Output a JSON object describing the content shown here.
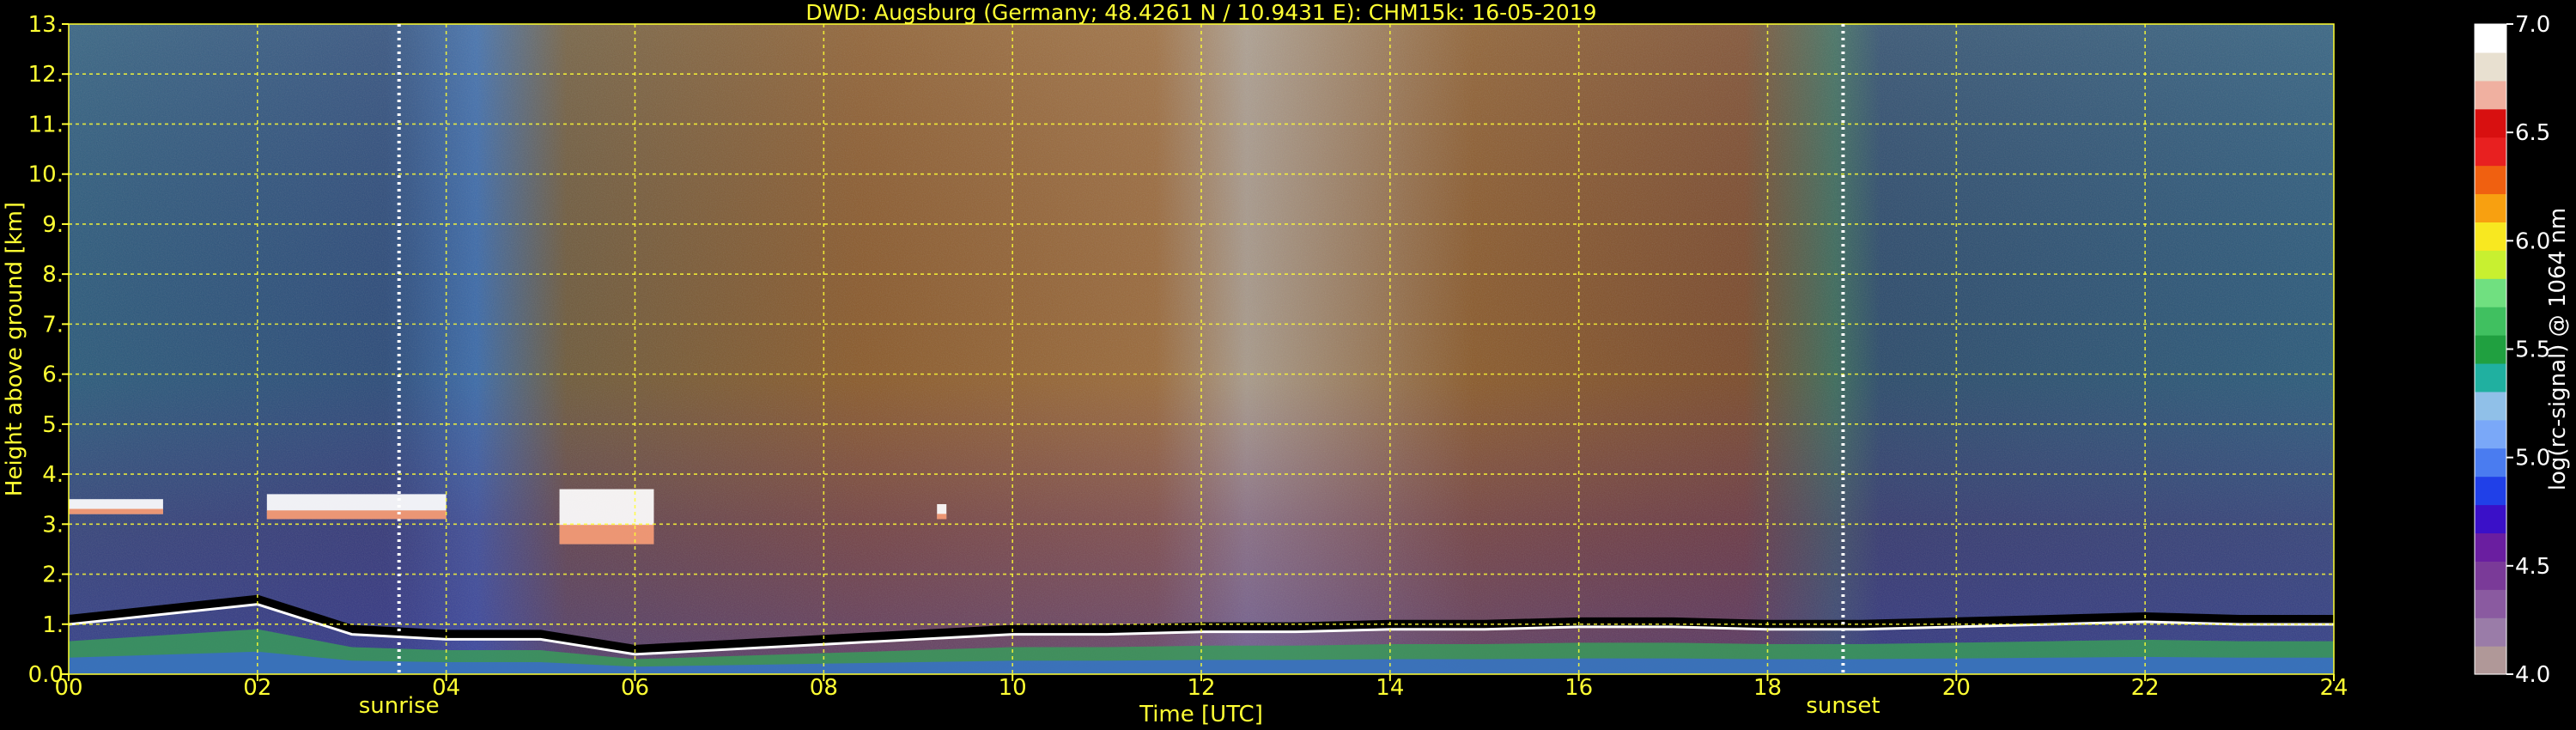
{
  "chart_data": {
    "type": "heatmap",
    "title": "DWD: Augsburg (Germany; 48.4261 N / 10.9431 E):    CHM15k: 16-05-2019",
    "xlabel": "Time [UTC]",
    "ylabel": "Height above ground [km]",
    "colorbar_label": "log(rc-signal) @ 1064 nm",
    "xlim": [
      0,
      24
    ],
    "ylim": [
      0,
      13
    ],
    "clim": [
      4.0,
      7.0
    ],
    "x_ticks": [
      "00",
      "02",
      "04",
      "06",
      "08",
      "10",
      "12",
      "14",
      "16",
      "18",
      "20",
      "22",
      "24"
    ],
    "y_ticks": [
      "0.0",
      "1.",
      "2.",
      "3.",
      "4.",
      "5.",
      "6.",
      "7.",
      "8.",
      "9.",
      "10.",
      "11.",
      "12.",
      "13."
    ],
    "colorbar_ticks": [
      "4.0",
      "4.5",
      "5.0",
      "5.5",
      "6.0",
      "6.5",
      "7.0"
    ],
    "grid": true,
    "grid_color": "#ffff33",
    "colormap": [
      "#b09898",
      "#9a7ca8",
      "#8a5aa0",
      "#7a3a98",
      "#6a1ea0",
      "#3a10c8",
      "#2040e8",
      "#4a7cf0",
      "#7aa8f8",
      "#90c0e8",
      "#20b0a0",
      "#20a040",
      "#40c060",
      "#70e080",
      "#c8f030",
      "#f8e820",
      "#f8a010",
      "#f06010",
      "#e82020",
      "#d81010",
      "#f0b0a0",
      "#e8e0d0",
      "#ffffff"
    ],
    "events": [
      {
        "label": "sunrise",
        "x": 3.5
      },
      {
        "label": "sunset",
        "x": 18.8
      }
    ],
    "cloud_layers": [
      {
        "x": [
          0.0,
          1.0
        ],
        "y": [
          3.2,
          3.5
        ]
      },
      {
        "x": [
          2.1,
          4.0
        ],
        "y": [
          3.1,
          3.6
        ]
      },
      {
        "x": [
          5.2,
          6.2
        ],
        "y": [
          2.6,
          3.7
        ]
      },
      {
        "x": [
          9.2,
          9.3
        ],
        "y": [
          3.1,
          3.4
        ]
      }
    ],
    "boundary_layer": {
      "x": [
        0,
        1,
        2,
        3,
        4,
        5,
        6,
        7,
        8,
        9,
        10,
        11,
        12,
        13,
        14,
        15,
        16,
        17,
        18,
        19,
        20,
        21,
        22,
        23,
        24
      ],
      "y": [
        1.1,
        1.3,
        1.5,
        0.9,
        0.8,
        0.8,
        0.5,
        0.6,
        0.7,
        0.8,
        0.9,
        0.9,
        0.95,
        0.95,
        1.0,
        1.0,
        1.05,
        1.05,
        1.0,
        1.0,
        1.05,
        1.1,
        1.15,
        1.1,
        1.1
      ]
    }
  }
}
